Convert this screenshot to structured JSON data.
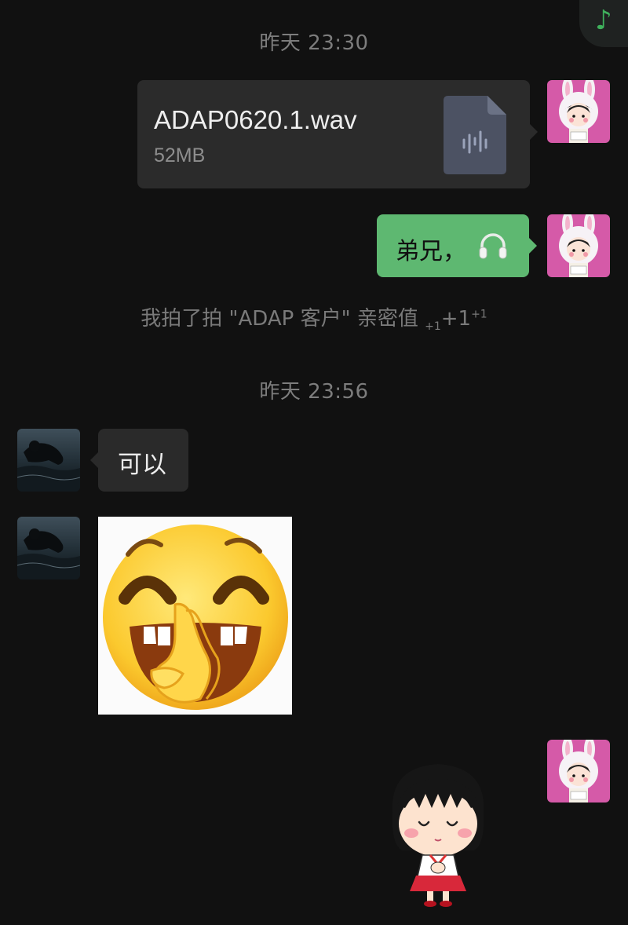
{
  "top_right_button": {
    "icon": "music-note-icon",
    "glyph": "♪",
    "color": "#3fb15c"
  },
  "timestamps": [
    "昨天 23:30",
    "昨天 23:56"
  ],
  "messages": {
    "file": {
      "name": "ADAP0620.1.wav",
      "size": "52MB",
      "icon": "audio-file-icon"
    },
    "text_out": {
      "text": "弟兄，",
      "icon": "headphones-icon",
      "bubble_color": "#5eb871"
    },
    "system_note": {
      "text": "我拍了拍 \"ADAP 客户\" 亲密值",
      "sub": "+1",
      "main": "+1",
      "sup": "+1"
    },
    "text_in": {
      "text": "可以"
    }
  },
  "stickers": {
    "incoming": "emoji-sticker-clap-laugh",
    "outgoing": "chibi-girl-sticker"
  },
  "avatars": {
    "me": "bunny-hood-girl-avatar",
    "contact": "ocean-swimmer-avatar"
  }
}
